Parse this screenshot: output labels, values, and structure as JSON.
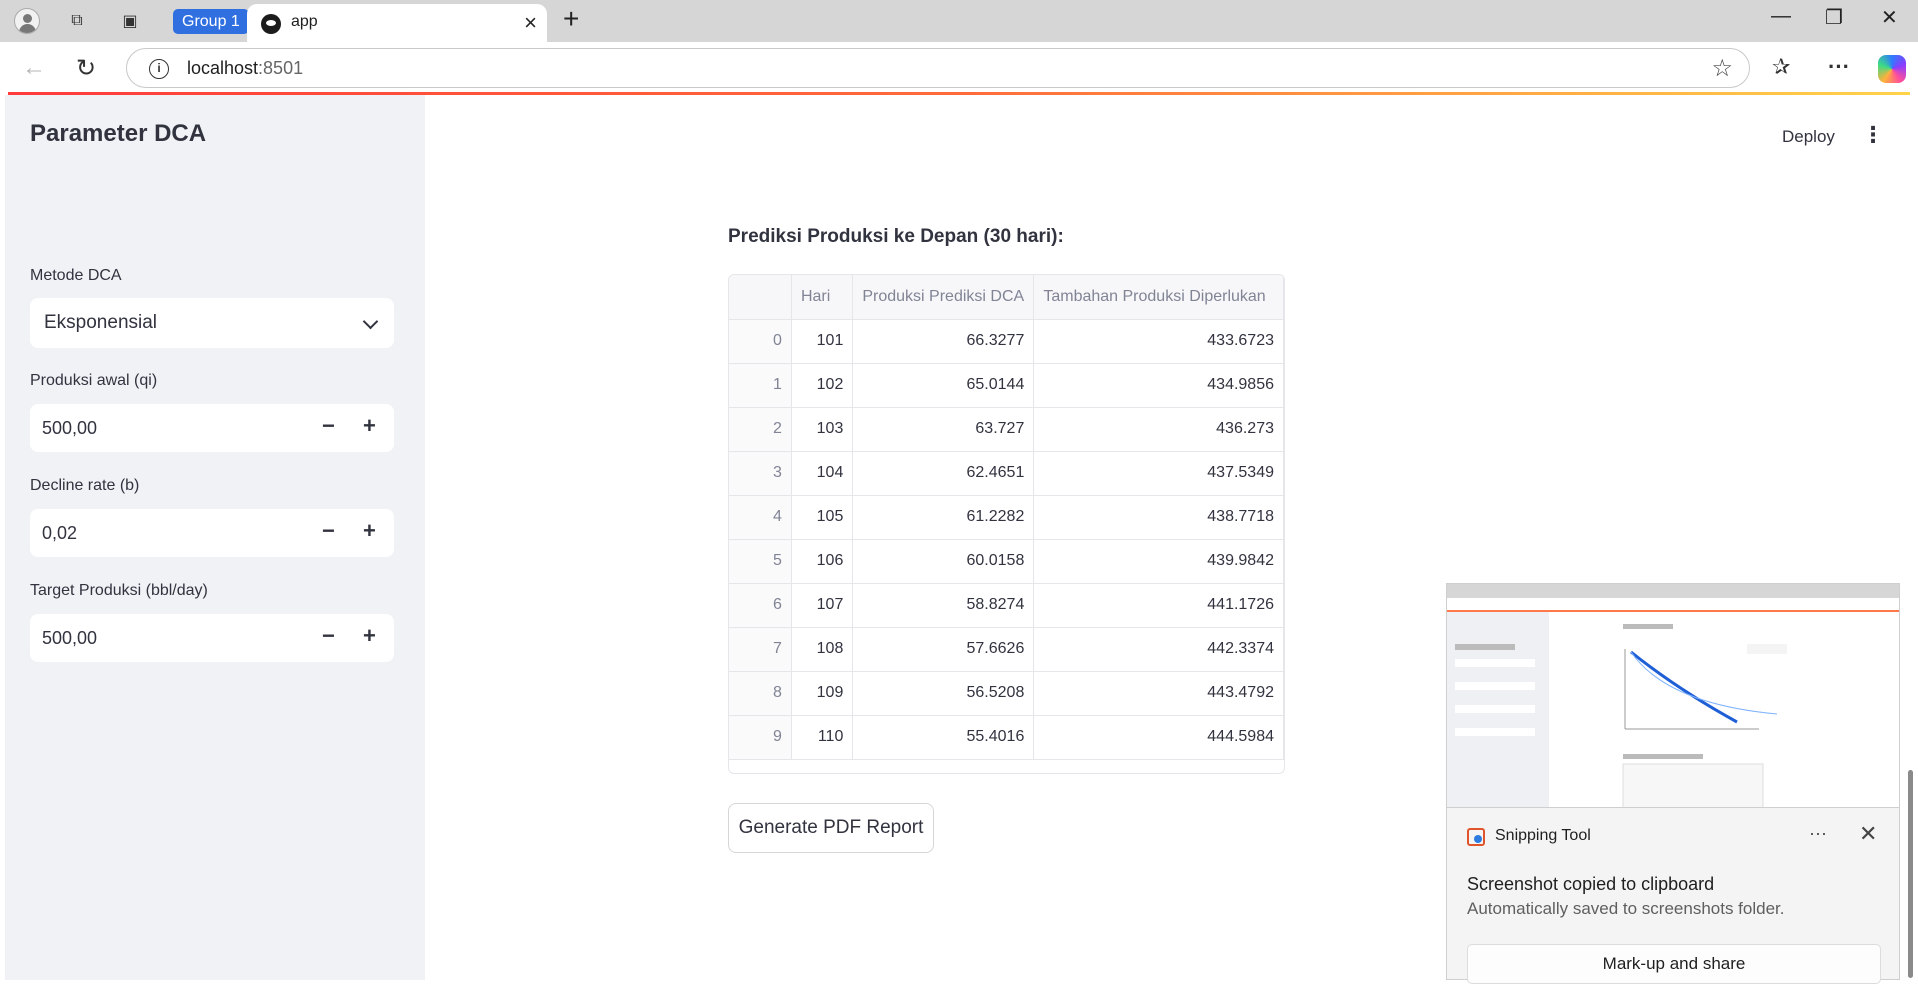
{
  "browser": {
    "group_label": "Group 1",
    "tab_title": "app",
    "url_host": "localhost",
    "url_port": ":8501"
  },
  "sidebar": {
    "title": "Parameter DCA",
    "method": {
      "label": "Metode DCA",
      "value": "Eksponensial"
    },
    "initial_production": {
      "label": "Produksi awal (qi)",
      "value": "500,00"
    },
    "decline_rate": {
      "label": "Decline rate (b)",
      "value": "0,02"
    },
    "target_production": {
      "label": "Target Produksi (bbl/day)",
      "value": "500,00"
    },
    "minus": "−",
    "plus": "+"
  },
  "header": {
    "deploy_label": "Deploy",
    "menu_glyph": "⋮"
  },
  "main": {
    "heading": "Prediksi Produksi ke Depan (30 hari):",
    "table": {
      "columns": [
        "",
        "Hari",
        "Produksi Prediksi DCA",
        "Tambahan Produksi Diperlukan"
      ],
      "rows": [
        [
          "0",
          "101",
          "66.3277",
          "433.6723"
        ],
        [
          "1",
          "102",
          "65.0144",
          "434.9856"
        ],
        [
          "2",
          "103",
          "63.727",
          "436.273"
        ],
        [
          "3",
          "104",
          "62.4651",
          "437.5349"
        ],
        [
          "4",
          "105",
          "61.2282",
          "438.7718"
        ],
        [
          "5",
          "106",
          "60.0158",
          "439.9842"
        ],
        [
          "6",
          "107",
          "58.8274",
          "441.1726"
        ],
        [
          "7",
          "108",
          "57.6626",
          "442.3374"
        ],
        [
          "8",
          "109",
          "56.5208",
          "443.4792"
        ],
        [
          "9",
          "110",
          "55.4016",
          "444.5984"
        ]
      ]
    },
    "pdf_button": "Generate PDF Report"
  },
  "snipping_tool": {
    "app_name": "Snipping Tool",
    "more_glyph": "···",
    "close_glyph": "✕",
    "message": "Screenshot copied to clipboard",
    "submessage": "Automatically saved to screenshots folder.",
    "action_button": "Mark-up and share"
  }
}
